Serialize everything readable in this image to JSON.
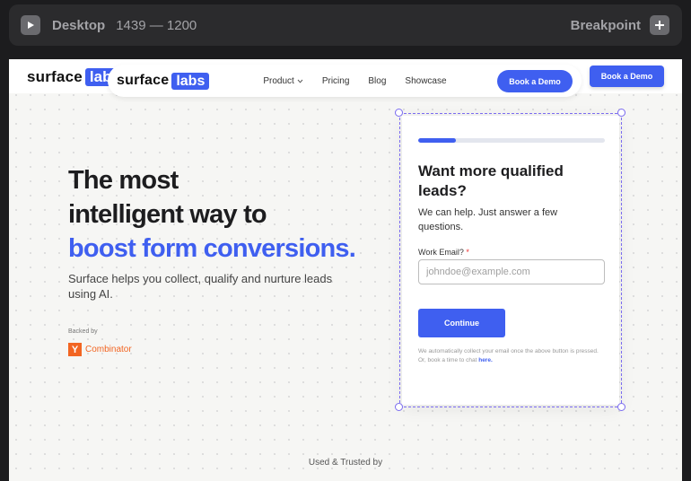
{
  "toolbar": {
    "device": "Desktop",
    "size": "1439 — 1200",
    "breakpoint": "Breakpoint",
    "icons": [
      "play-icon",
      "plus-icon"
    ]
  },
  "site": {
    "logo_word": "surface",
    "logo_highlight": "labs",
    "nav": {
      "product": "Product",
      "pricing": "Pricing",
      "blog": "Blog",
      "showcase": "Showcase",
      "cta": "Book a Demo"
    },
    "header_cta": "Book a Demo"
  },
  "hero": {
    "title_line1": "The most",
    "title_line2": "intelligent way to",
    "title_line3": "boost form conversions.",
    "subtitle": "Surface helps you collect, qualify and nurture leads using AI.",
    "backed_by": "Backed by",
    "backer_mark": "Y",
    "backer_name": "Combinator"
  },
  "form": {
    "progress_fraction": 0.2,
    "title": "Want more qualified leads?",
    "subtitle": "We can help. Just answer a few questions.",
    "email_label": "Work Email?",
    "email_required": "*",
    "email_placeholder": "johndoe@example.com",
    "email_value": "",
    "continue": "Continue",
    "fineprint": "We automatically collect your email once the above button is pressed. Or, book a time to chat",
    "fineprint_link": "here."
  },
  "footer": {
    "used_trusted": "Used & Trusted by"
  },
  "colors": {
    "accent": "#3f5ff0",
    "yc_orange": "#f26522",
    "selection": "#7b6cf0"
  }
}
